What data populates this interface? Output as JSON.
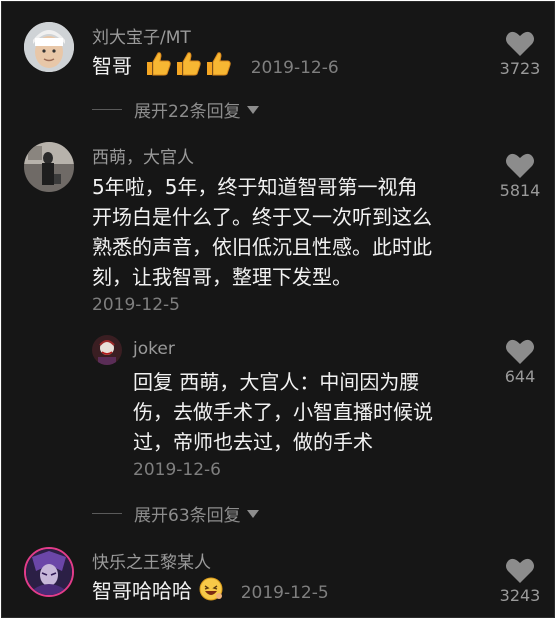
{
  "comments": [
    {
      "username": "刘大宝子/MT",
      "text": "智哥",
      "date": "2019-12-6",
      "likes": "3723",
      "expand_label": "展开22条回复"
    },
    {
      "username": "西萌，大官人",
      "text_lines": [
        "5年啦，5年，终于知道智哥第一视角",
        "开场白是什么了。终于又一次听到这么",
        "熟悉的声音，依旧低沉且性感。此时此",
        "刻，让我智哥，整理下发型。"
      ],
      "date": "2019-12-5",
      "likes": "5814"
    },
    {
      "username": "快乐之王黎某人",
      "text": "智哥哈哈哈",
      "date": "2019-12-5",
      "likes": "3243"
    }
  ],
  "reply": {
    "username": "joker",
    "text_lines": [
      "回复 西萌，大官人：中间因为腰",
      "伤，去做手术了，小智直播时候说",
      "过，帝师也去过，做的手术"
    ],
    "date": "2019-12-6",
    "likes": "644",
    "expand_label": "展开63条回复"
  },
  "icons": {
    "like": "heart-icon",
    "thumbs": "thumbs-up-emoji",
    "laugh": "laughing-emoji",
    "expand": "caret-down-icon"
  },
  "colors": {
    "background": "#161616",
    "username": "#9a9a9a",
    "text": "#f2f2f2",
    "thumbs": "#f5a623"
  }
}
